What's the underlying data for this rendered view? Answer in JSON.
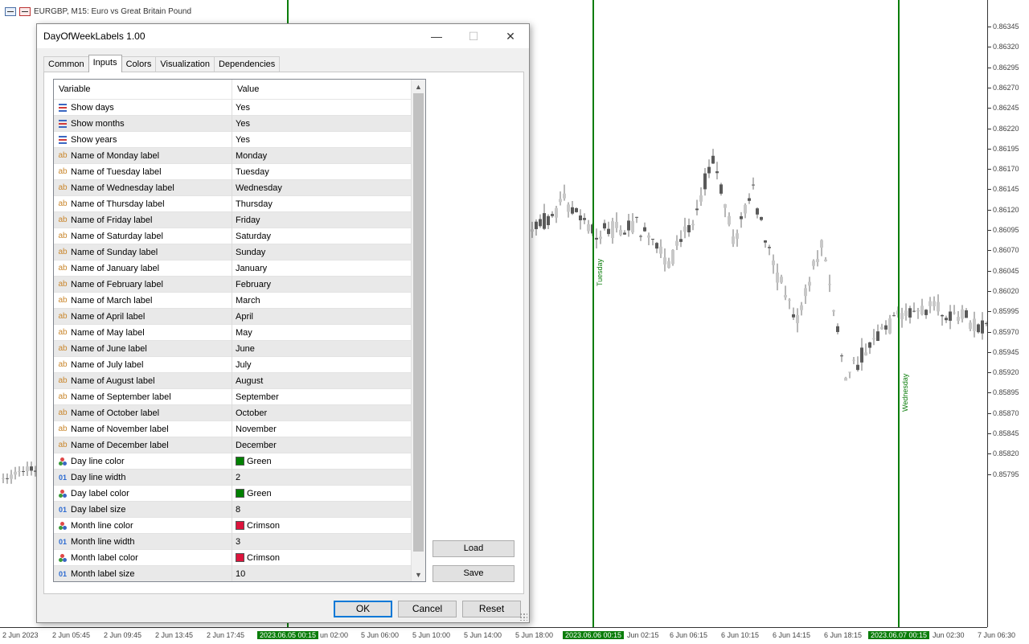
{
  "chart": {
    "title": "EURGBP, M15:  Euro vs Great Britain Pound",
    "prices": [
      "0.86345",
      "0.86320",
      "0.86295",
      "0.86270",
      "0.86245",
      "0.86220",
      "0.86195",
      "0.86170",
      "0.86145",
      "0.86120",
      "0.86095",
      "0.86070",
      "0.86045",
      "0.86020",
      "0.85995",
      "0.85970",
      "0.85945",
      "0.85920",
      "0.85895",
      "0.85870",
      "0.85845",
      "0.85820",
      "0.85795"
    ],
    "times": [
      "2 Jun 2023",
      "2 Jun 05:45",
      "2 Jun 09:45",
      "2 Jun 13:45",
      "2 Jun 17:45",
      "2023.06.05 00:15",
      "un 02:00",
      "5 Jun 06:00",
      "5 Jun 10:00",
      "5 Jun 14:00",
      "5 Jun 18:00",
      "2023.06.06 00:15",
      "Jun 02:15",
      "6 Jun 06:15",
      "6 Jun 10:15",
      "6 Jun 14:15",
      "6 Jun 18:15",
      "2023.06.07 00:15",
      "Jun 02:30",
      "7 Jun 06:30"
    ],
    "day_labels": [
      "Tuesday",
      "Wednesday"
    ],
    "line_color": "#0a7d0a"
  },
  "dialog": {
    "title": "DayOfWeekLabels 1.00",
    "tabs": [
      "Common",
      "Inputs",
      "Colors",
      "Visualization",
      "Dependencies"
    ],
    "active_tab": "Inputs",
    "columns": [
      "Variable",
      "Value"
    ],
    "rows": [
      {
        "type": "enum",
        "name": "Show days",
        "value": "Yes"
      },
      {
        "type": "enum",
        "name": "Show months",
        "value": "Yes"
      },
      {
        "type": "enum",
        "name": "Show years",
        "value": "Yes"
      },
      {
        "type": "string",
        "name": "Name of Monday label",
        "value": "Monday"
      },
      {
        "type": "string",
        "name": "Name of Tuesday label",
        "value": "Tuesday"
      },
      {
        "type": "string",
        "name": "Name of Wednesday label",
        "value": "Wednesday"
      },
      {
        "type": "string",
        "name": "Name of Thursday label",
        "value": "Thursday"
      },
      {
        "type": "string",
        "name": "Name of Friday label",
        "value": "Friday"
      },
      {
        "type": "string",
        "name": "Name of Saturday label",
        "value": "Saturday"
      },
      {
        "type": "string",
        "name": "Name of Sunday label",
        "value": "Sunday"
      },
      {
        "type": "string",
        "name": "Name of January label",
        "value": "January"
      },
      {
        "type": "string",
        "name": "Name of February label",
        "value": "February"
      },
      {
        "type": "string",
        "name": "Name of March label",
        "value": "March"
      },
      {
        "type": "string",
        "name": "Name of April label",
        "value": "April"
      },
      {
        "type": "string",
        "name": "Name of May label",
        "value": "May"
      },
      {
        "type": "string",
        "name": "Name of June label",
        "value": "June"
      },
      {
        "type": "string",
        "name": "Name of July label",
        "value": "July"
      },
      {
        "type": "string",
        "name": "Name of August label",
        "value": "August"
      },
      {
        "type": "string",
        "name": "Name of September label",
        "value": "September"
      },
      {
        "type": "string",
        "name": "Name of October label",
        "value": "October"
      },
      {
        "type": "string",
        "name": "Name of November label",
        "value": "November"
      },
      {
        "type": "string",
        "name": "Name of December label",
        "value": "December"
      },
      {
        "type": "color",
        "name": "Day line color",
        "value": "Green",
        "swatch": "#008000"
      },
      {
        "type": "int",
        "name": "Day line width",
        "value": "2"
      },
      {
        "type": "color",
        "name": "Day label color",
        "value": "Green",
        "swatch": "#008000"
      },
      {
        "type": "int",
        "name": "Day label size",
        "value": "8"
      },
      {
        "type": "color",
        "name": "Month line color",
        "value": "Crimson",
        "swatch": "#dc143c"
      },
      {
        "type": "int",
        "name": "Month line width",
        "value": "3"
      },
      {
        "type": "color",
        "name": "Month label color",
        "value": "Crimson",
        "swatch": "#dc143c"
      },
      {
        "type": "int",
        "name": "Month label size",
        "value": "10"
      }
    ],
    "side_buttons": {
      "load": "Load",
      "save": "Save"
    },
    "footer": {
      "ok": "OK",
      "cancel": "Cancel",
      "reset": "Reset"
    },
    "window_controls": {
      "minimize": "—",
      "maximize": "☐",
      "close": "✕"
    }
  }
}
